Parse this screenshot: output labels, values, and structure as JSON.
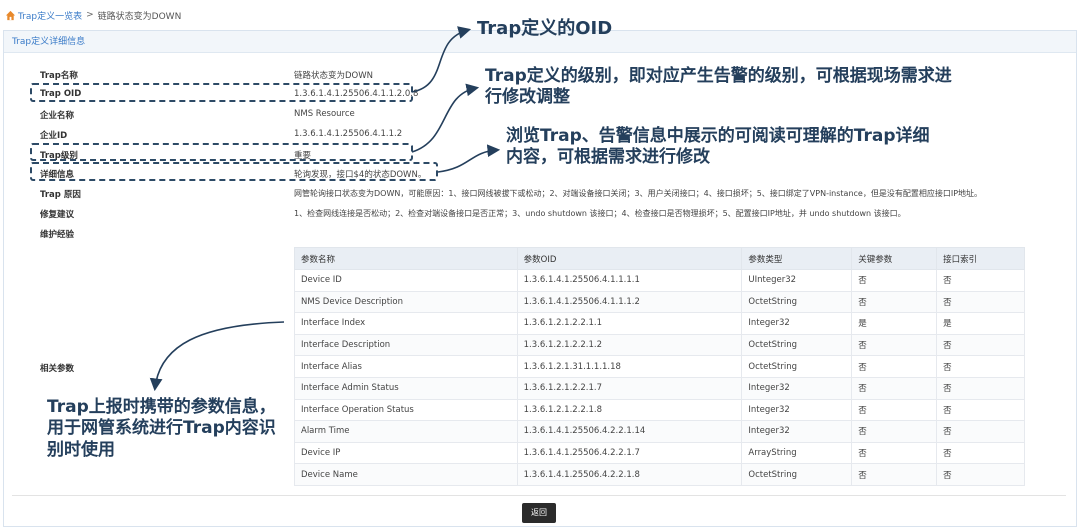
{
  "breadcrumb": {
    "root": "Trap定义一览表",
    "separator": ">",
    "current": "链路状态变为DOWN"
  },
  "panel": {
    "title": "Trap定义详细信息"
  },
  "fields": {
    "trap_name": {
      "label": "Trap名称",
      "value": "链路状态变为DOWN"
    },
    "trap_oid": {
      "label": "Trap OID",
      "value": "1.3.6.1.4.1.25506.4.1.1.2.0.8"
    },
    "enterprise_name": {
      "label": "企业名称",
      "value": "NMS Resource"
    },
    "enterprise_id": {
      "label": "企业ID",
      "value": "1.3.6.1.4.1.25506.4.1.1.2"
    },
    "trap_level": {
      "label": "Trap级别",
      "value": "重要"
    },
    "detail": {
      "label": "详细信息",
      "value": "轮询发现，接口$4的状态DOWN。"
    },
    "cause": {
      "label": "Trap 原因",
      "value": "网管轮询接口状态变为DOWN，可能原因：1、接口网线被拔下或松动；2、对端设备接口关闭；3、用户关闭接口；4、接口损坏；5、接口绑定了VPN-instance，但是没有配置相应接口IP地址。"
    },
    "suggestion": {
      "label": "修复建议",
      "value": "1、检查网线连接是否松动；2、检查对端设备接口是否正常；3、undo shutdown 该接口；4、检查接口是否物理损坏；5、配置接口IP地址，并 undo shutdown 该接口。"
    },
    "experience": {
      "label": "维护经验",
      "value": ""
    },
    "related": {
      "label": "相关参数"
    }
  },
  "params": {
    "headers": [
      "参数名称",
      "参数OID",
      "参数类型",
      "关键参数",
      "接口索引"
    ],
    "rows": [
      [
        "Device ID",
        "1.3.6.1.4.1.25506.4.1.1.1.1",
        "UInteger32",
        "否",
        "否"
      ],
      [
        "NMS Device Description",
        "1.3.6.1.4.1.25506.4.1.1.1.2",
        "OctetString",
        "否",
        "否"
      ],
      [
        "Interface Index",
        "1.3.6.1.2.1.2.2.1.1",
        "Integer32",
        "是",
        "是"
      ],
      [
        "Interface Description",
        "1.3.6.1.2.1.2.2.1.2",
        "OctetString",
        "否",
        "否"
      ],
      [
        "Interface Alias",
        "1.3.6.1.2.1.31.1.1.1.18",
        "OctetString",
        "否",
        "否"
      ],
      [
        "Interface Admin Status",
        "1.3.6.1.2.1.2.2.1.7",
        "Integer32",
        "否",
        "否"
      ],
      [
        "Interface Operation Status",
        "1.3.6.1.2.1.2.2.1.8",
        "Integer32",
        "否",
        "否"
      ],
      [
        "Alarm Time",
        "1.3.6.1.4.1.25506.4.2.2.1.14",
        "Integer32",
        "否",
        "否"
      ],
      [
        "Device IP",
        "1.3.6.1.4.1.25506.4.2.2.1.7",
        "ArrayString",
        "否",
        "否"
      ],
      [
        "Device Name",
        "1.3.6.1.4.1.25506.4.2.2.1.8",
        "OctetString",
        "否",
        "否"
      ]
    ]
  },
  "back_button": "返回",
  "annotations": {
    "oid": "Trap定义的OID",
    "level": "Trap定义的级别，即对应产生告警的级别，可根据现场需求进行修改调整",
    "detail": "浏览Trap、告警信息中展示的可阅读可理解的Trap详细内容，可根据需求进行修改",
    "params": "Trap上报时携带的参数信息，用于网管系统进行Trap内容识别时使用"
  },
  "colors": {
    "link": "#3a7bc8",
    "annotation": "#243f5c",
    "header_bg": "#e9eef4"
  }
}
